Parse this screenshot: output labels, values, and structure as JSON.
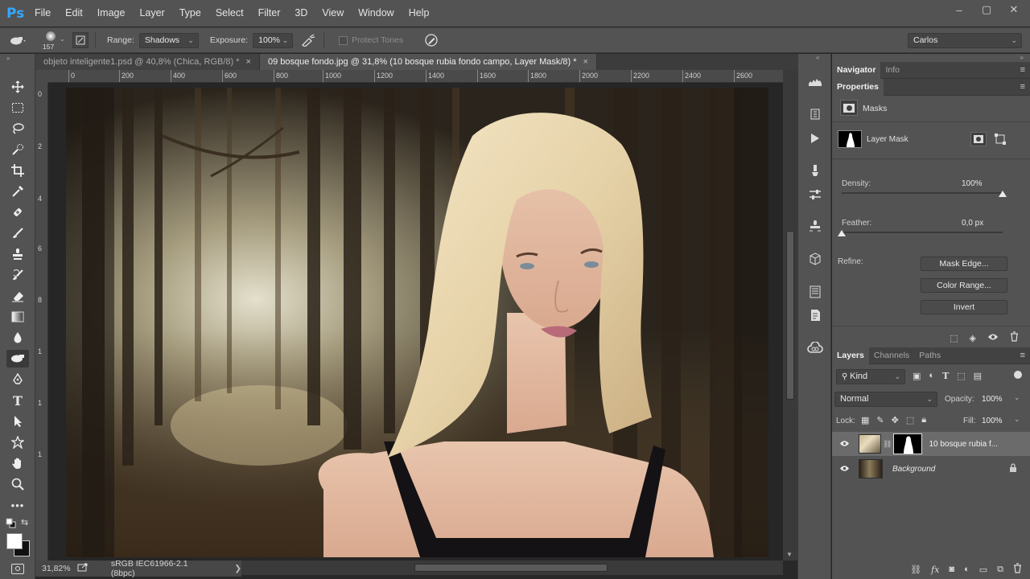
{
  "app": {
    "logo": "Ps",
    "menu": [
      "File",
      "Edit",
      "Image",
      "Layer",
      "Type",
      "Select",
      "Filter",
      "3D",
      "View",
      "Window",
      "Help"
    ],
    "window_controls": [
      "–",
      "▢",
      "✕"
    ]
  },
  "options_bar": {
    "brush_size": "157",
    "range_label": "Range:",
    "range_value": "Shadows",
    "exposure_label": "Exposure:",
    "exposure_value": "100%",
    "protect_tones": "Protect Tones",
    "workspace": "Carlos"
  },
  "tabs": [
    {
      "label": "objeto inteligente1.psd @ 40,8% (Chica, RGB/8) *",
      "close": "×"
    },
    {
      "label": "09 bosque fondo.jpg @ 31,8% (10 bosque rubia fondo campo, Layer Mask/8) *",
      "close": "×"
    }
  ],
  "ruler_top": [
    "0",
    "200",
    "400",
    "600",
    "800",
    "1000",
    "1200",
    "1400",
    "1600",
    "1800",
    "2000",
    "2200",
    "2400",
    "2600"
  ],
  "ruler_left": [
    "0",
    "2",
    "4",
    "6",
    "8",
    "1",
    "1",
    "1"
  ],
  "status": {
    "zoom": "31,82%",
    "profile": "sRGB IEC61966-2.1 (8bpc)",
    "arrow": "❯"
  },
  "panels": {
    "top_tabs": [
      "Navigator",
      "Info"
    ],
    "properties_title": "Properties",
    "masks_label": "Masks",
    "layer_mask_label": "Layer Mask",
    "density_label": "Density:",
    "density_value": "100%",
    "density_level": 1.0,
    "feather_label": "Feather:",
    "feather_value": "0,0 px",
    "feather_level": 0.0,
    "refine_label": "Refine:",
    "mask_edge_btn": "Mask Edge...",
    "color_range_btn": "Color Range...",
    "invert_btn": "Invert"
  },
  "layers_panel": {
    "tabs": [
      "Layers",
      "Channels",
      "Paths"
    ],
    "filter_kind": "Kind",
    "blend_mode": "Normal",
    "opacity_label": "Opacity:",
    "opacity_value": "100%",
    "lock_label": "Lock:",
    "fill_label": "Fill:",
    "fill_value": "100%",
    "layers": [
      {
        "name": "10 bosque rubia f...",
        "visible": true,
        "selected": true
      },
      {
        "name": "Background",
        "visible": true,
        "selected": false
      }
    ]
  }
}
